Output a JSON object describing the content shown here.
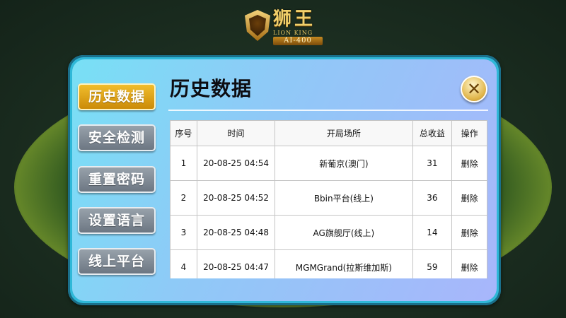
{
  "logo": {
    "title": "狮王",
    "subtitle": "LION KING",
    "badge": "AI-400"
  },
  "close": {
    "glyph": "✕"
  },
  "sidebar": {
    "items": [
      {
        "label": "历史数据",
        "active": true
      },
      {
        "label": "安全检测",
        "active": false
      },
      {
        "label": "重置密码",
        "active": false
      },
      {
        "label": "设置语言",
        "active": false
      },
      {
        "label": "线上平台",
        "active": false
      }
    ]
  },
  "main": {
    "title": "历史数据",
    "table": {
      "headers": [
        "序号",
        "时间",
        "开局场所",
        "总收益",
        "操作"
      ],
      "rows": [
        {
          "index": "1",
          "time": "20-08-25 04:54",
          "venue": "新葡京(澳门)",
          "profit": "31",
          "action": "删除"
        },
        {
          "index": "2",
          "time": "20-08-25 04:52",
          "venue": "Bbin平台(线上)",
          "profit": "36",
          "action": "删除"
        },
        {
          "index": "3",
          "time": "20-08-25 04:48",
          "venue": "AG旗舰厅(线上)",
          "profit": "14",
          "action": "删除"
        },
        {
          "index": "4",
          "time": "20-08-25 04:47",
          "venue": "MGMGrand(拉斯维加斯)",
          "profit": "59",
          "action": "删除"
        }
      ]
    }
  },
  "colors": {
    "active_button": "#e0a51a",
    "inactive_button": "#808a95",
    "panel_border": "#2fb8d8"
  }
}
